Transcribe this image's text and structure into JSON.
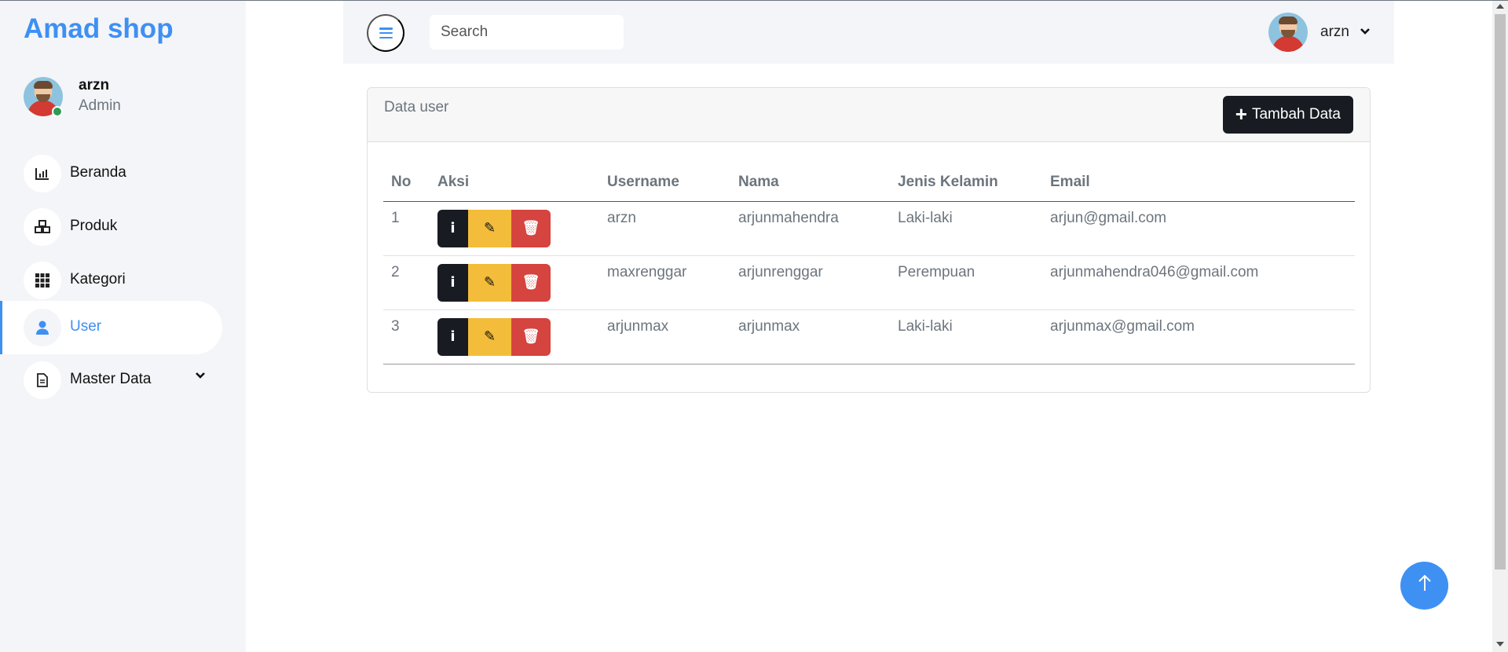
{
  "brand": "Amad shop",
  "profile": {
    "name": "arzn",
    "role": "Admin"
  },
  "sidebar": {
    "items": [
      {
        "label": "Beranda",
        "icon": "bar-chart-icon",
        "active": false
      },
      {
        "label": "Produk",
        "icon": "cubes-icon",
        "active": false
      },
      {
        "label": "Kategori",
        "icon": "grid-icon",
        "active": false
      },
      {
        "label": "User",
        "icon": "user-icon",
        "active": true
      },
      {
        "label": "Master Data",
        "icon": "file-icon",
        "active": false,
        "has_submenu": true
      }
    ]
  },
  "header": {
    "search_placeholder": "Search",
    "user_name": "arzn"
  },
  "card": {
    "title": "Data user",
    "add_button_label": "Tambah Data"
  },
  "table": {
    "columns": [
      "No",
      "Aksi",
      "Username",
      "Nama",
      "Jenis Kelamin",
      "Email"
    ],
    "rows": [
      {
        "no": "1",
        "username": "arzn",
        "nama": "arjunmahendra",
        "jenis_kelamin": "Laki-laki",
        "email": "arjun@gmail.com"
      },
      {
        "no": "2",
        "username": "maxrenggar",
        "nama": "arjunrenggar",
        "jenis_kelamin": "Perempuan",
        "email": "arjunmahendra046@gmail.com"
      },
      {
        "no": "3",
        "username": "arjunmax",
        "nama": "arjunmax",
        "jenis_kelamin": "Laki-laki",
        "email": "arjunmax@gmail.com"
      }
    ]
  },
  "colors": {
    "accent": "#3e90f3",
    "sidebar_bg": "#f4f5f8",
    "btn_dark": "#181b22",
    "btn_warning": "#f3bd3b",
    "btn_danger": "#d5443f",
    "status_online": "#2e9b55"
  }
}
